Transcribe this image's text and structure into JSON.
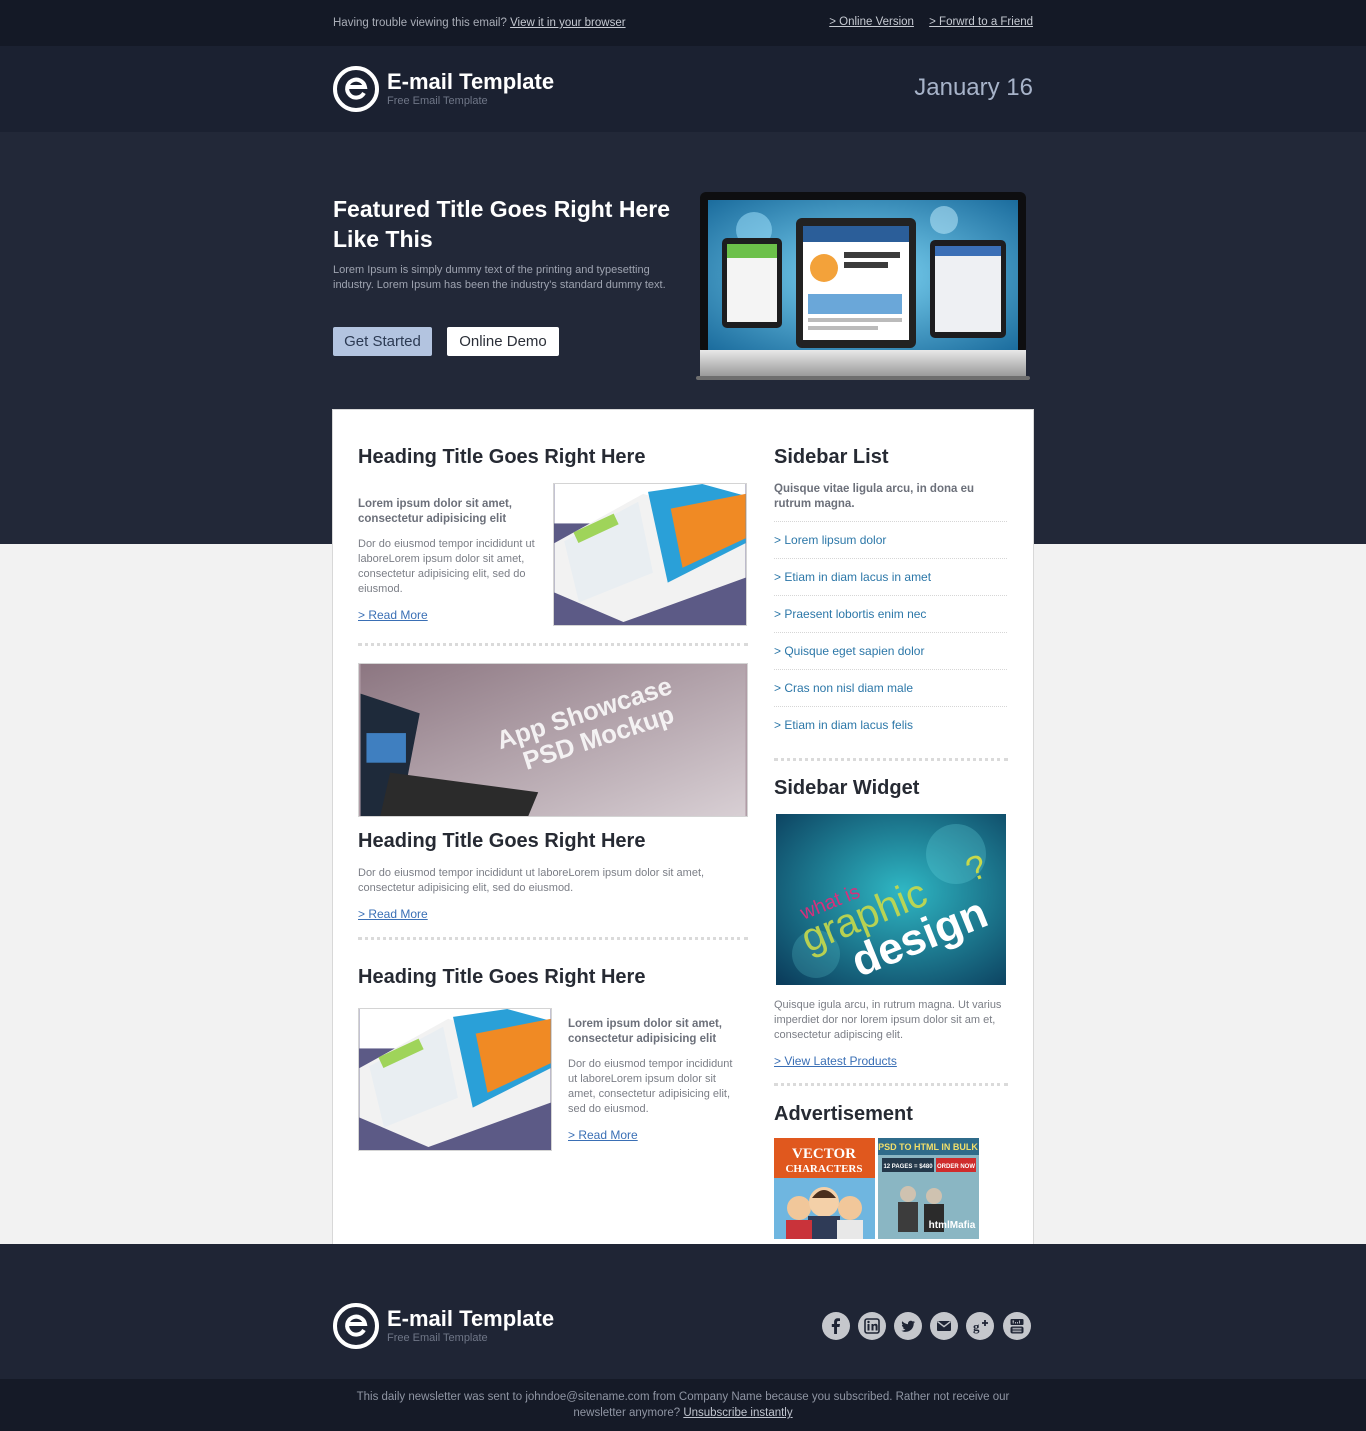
{
  "topbar": {
    "trouble_text": "Having trouble viewing this email?",
    "browser_link": "View it in your browser",
    "online_version": "> Online Version",
    "forward": "> Forwrd to a Friend"
  },
  "header": {
    "logo_name": "E-mail Template",
    "logo_tagline": "Free Email Template",
    "date": "January 16"
  },
  "hero": {
    "title": "Featured Title Goes Right Here Like This",
    "text": "Lorem Ipsum is simply dummy text of the printing and typesetting industry. Lorem Ipsum has been the industry's standard dummy text.",
    "primary_button": "Get Started",
    "secondary_button": "Online Demo"
  },
  "main": {
    "article1": {
      "heading": "Heading Title Goes Right Here",
      "lead": "Lorem ipsum dolor sit amet, consectetur adipisicing elit",
      "body": "Dor do eiusmod tempor incididunt ut laboreLorem ipsum dolor sit amet, consectetur adipisicing elit, sed do eiusmod.",
      "read_more": "> Read More"
    },
    "article2": {
      "banner_text_1": "App Showcase",
      "banner_text_2": "PSD Mockup",
      "heading": "Heading Title Goes Right Here",
      "body": "Dor do eiusmod tempor incididunt ut laboreLorem ipsum dolor sit amet, consectetur adipisicing elit, sed do eiusmod.",
      "read_more": "> Read More"
    },
    "article3": {
      "heading": "Heading Title Goes Right Here",
      "lead": "Lorem ipsum dolor sit amet, consectetur adipisicing elit",
      "body": "Dor do eiusmod tempor incididunt ut laboreLorem ipsum dolor sit amet, consectetur adipisicing elit, sed do eiusmod.",
      "read_more": "> Read More"
    }
  },
  "sidebar": {
    "list_title": "Sidebar List",
    "list_intro": "Quisque vitae ligula arcu, in dona eu rutrum magna.",
    "links": [
      "> Lorem lipsum dolor",
      "> Etiam in diam lacus in amet",
      "> Praesent lobortis enim nec",
      "> Quisque eget sapien dolor",
      "> Cras non nisl diam male",
      "> Etiam in diam lacus felis"
    ],
    "widget_title": "Sidebar Widget",
    "widget_image_words": [
      "what is",
      "graphic",
      "design",
      "?"
    ],
    "widget_text": "Quisque igula arcu, in rutrum magna. Ut varius imperdiet dor nor lorem ipsum dolor sit am et, consectetur adipiscing elit.",
    "widget_link": "> View Latest Products",
    "ad_title": "Advertisement",
    "ad1": {
      "line1": "VECTOR",
      "line2": "CHARACTERS"
    },
    "ad2": {
      "line1": "PSD TO HTML IN BULK",
      "line2": "12 PAGES = $480",
      "cta": "ORDER NOW",
      "brand": "htmlMafia"
    }
  },
  "footer": {
    "logo_name": "E-mail Template",
    "logo_tagline": "Free Email Template",
    "social": [
      "facebook-icon",
      "linkedin-icon",
      "twitter-icon",
      "email-icon",
      "google-plus-icon",
      "youtube-icon"
    ],
    "notice": "This daily newsletter was sent to johndoe@sitename.com from Company Name because you subscribed. Rather not receive our newsletter anymore?",
    "unsubscribe": "Unsubscribe instantly"
  },
  "colors": {
    "top_bar": "#141926",
    "header": "#1b2131",
    "hero": "#222838",
    "link_blue": "#2c77a8",
    "button_primary": "#b3c4e0"
  }
}
